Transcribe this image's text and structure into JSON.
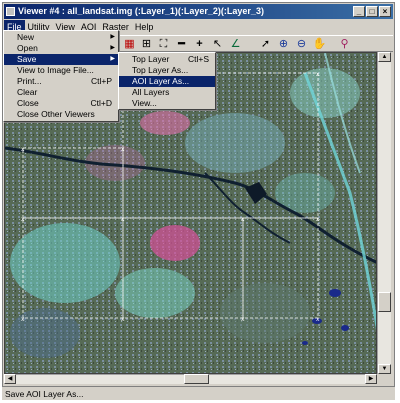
{
  "window": {
    "title": "Viewer #4 : all_landsat.img (:Layer_1)(:Layer_2)(:Layer_3)",
    "buttons": {
      "minimize": "_",
      "maximize": "□",
      "close": "×"
    }
  },
  "menubar": {
    "items": [
      {
        "label": "File"
      },
      {
        "label": "Utility"
      },
      {
        "label": "View"
      },
      {
        "label": "AOI"
      },
      {
        "label": "Raster"
      },
      {
        "label": "Help"
      }
    ]
  },
  "file_menu": {
    "items": [
      {
        "label": "New",
        "submenu": true
      },
      {
        "label": "Open",
        "submenu": true
      },
      {
        "label": "Save",
        "submenu": true,
        "highlighted": true
      },
      {
        "label": "View to Image File..."
      },
      {
        "label": "Print...",
        "shortcut": "Ctl+P"
      },
      {
        "label": "Clear"
      },
      {
        "label": "Close",
        "shortcut": "Ctl+D"
      },
      {
        "label": "Close Other Viewers"
      }
    ]
  },
  "save_submenu": {
    "items": [
      {
        "label": "Top Layer",
        "shortcut": "Ctl+S"
      },
      {
        "label": "Top Layer As..."
      },
      {
        "label": "AOI Layer As...",
        "highlighted": true
      },
      {
        "label": "All Layers"
      },
      {
        "label": "View..."
      }
    ]
  },
  "toolbar": {
    "icons": [
      "grid-icon",
      "fit-icon",
      "zoom-extent-icon",
      "measure-icon",
      "crosshair-icon",
      "inquire-icon",
      "profile-icon",
      "select-arrow-icon",
      "zoom-in-icon",
      "zoom-out-icon",
      "pan-hand-icon",
      "info-icon"
    ]
  },
  "statusbar": {
    "text": "Save AOI Layer As..."
  },
  "colors": {
    "title_bar": "#0a246a",
    "highlight": "#0a246a",
    "chrome": "#d4d0c8"
  }
}
